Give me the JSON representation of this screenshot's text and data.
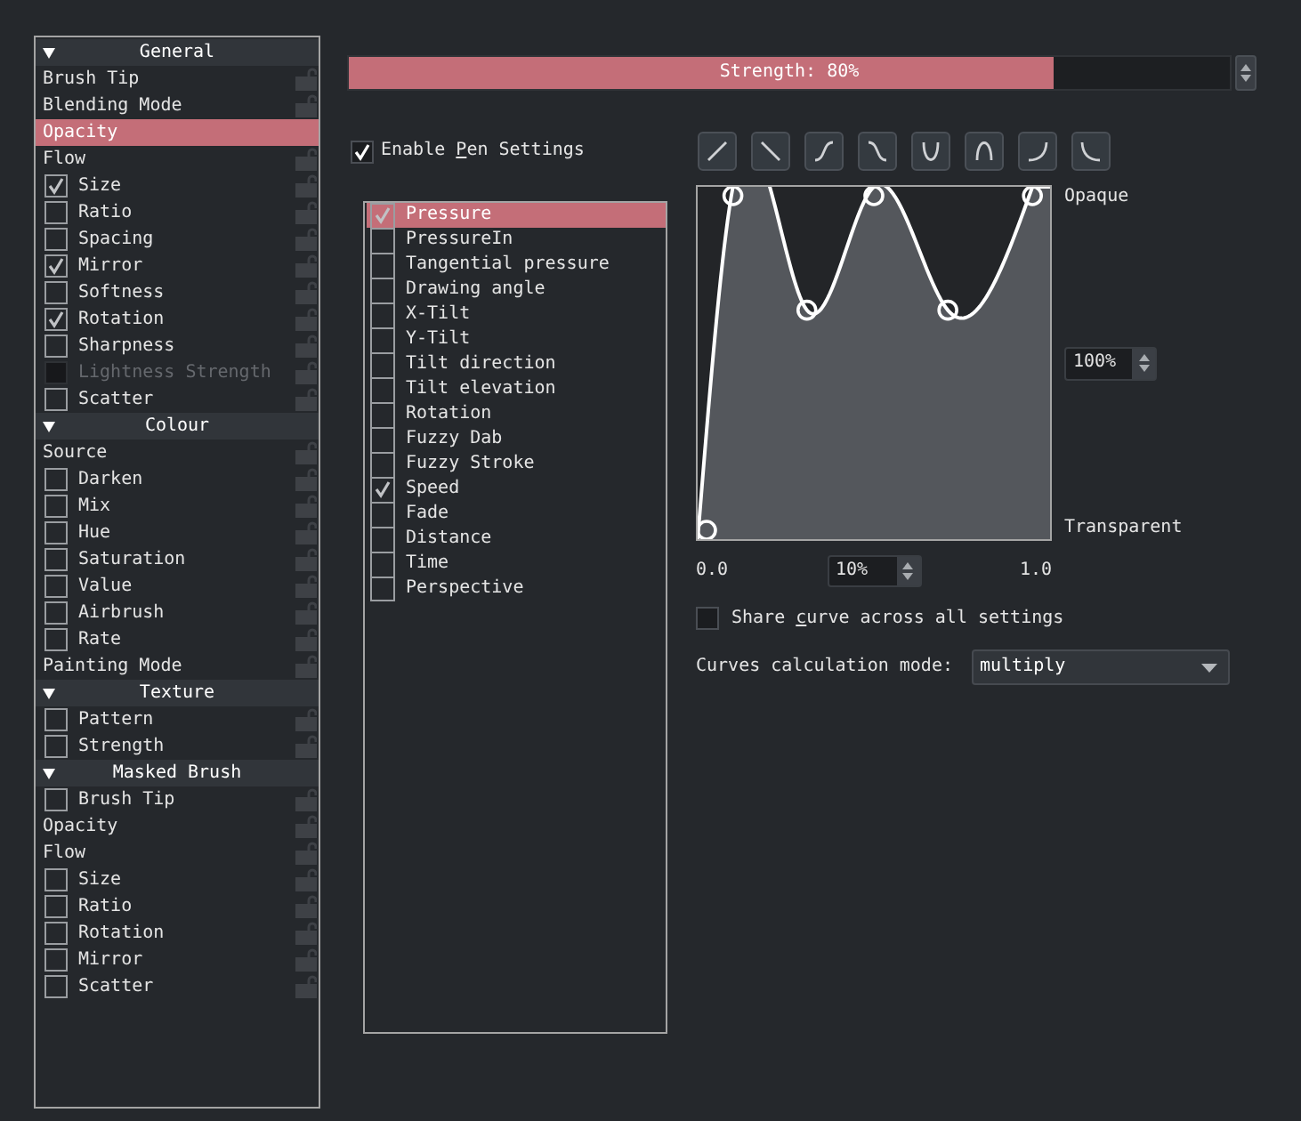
{
  "options_panel": {
    "sections": [
      {
        "title": "General",
        "expanded": true,
        "items": [
          {
            "kind": "plain",
            "label": "Brush Tip",
            "selected": false,
            "disabled": false
          },
          {
            "kind": "plain",
            "label": "Blending Mode",
            "selected": false,
            "disabled": false
          },
          {
            "kind": "plain",
            "label": "Opacity",
            "selected": true,
            "disabled": false
          },
          {
            "kind": "plain",
            "label": "Flow",
            "selected": false,
            "disabled": false
          },
          {
            "kind": "checkbox",
            "label": "Size",
            "checked": true,
            "selected": false,
            "disabled": false
          },
          {
            "kind": "checkbox",
            "label": "Ratio",
            "checked": false,
            "selected": false,
            "disabled": false
          },
          {
            "kind": "checkbox",
            "label": "Spacing",
            "checked": false,
            "selected": false,
            "disabled": false
          },
          {
            "kind": "checkbox",
            "label": "Mirror",
            "checked": true,
            "selected": false,
            "disabled": false
          },
          {
            "kind": "checkbox",
            "label": "Softness",
            "checked": false,
            "selected": false,
            "disabled": false
          },
          {
            "kind": "checkbox",
            "label": "Rotation",
            "checked": true,
            "selected": false,
            "disabled": false
          },
          {
            "kind": "checkbox",
            "label": "Sharpness",
            "checked": false,
            "selected": false,
            "disabled": false
          },
          {
            "kind": "checkbox",
            "label": "Lightness Strength",
            "checked": false,
            "selected": false,
            "disabled": true
          },
          {
            "kind": "checkbox",
            "label": "Scatter",
            "checked": false,
            "selected": false,
            "disabled": false
          }
        ]
      },
      {
        "title": "Colour",
        "expanded": true,
        "items": [
          {
            "kind": "plain",
            "label": "Source",
            "selected": false,
            "disabled": false
          },
          {
            "kind": "checkbox",
            "label": "Darken",
            "checked": false,
            "selected": false,
            "disabled": false
          },
          {
            "kind": "checkbox",
            "label": "Mix",
            "checked": false,
            "selected": false,
            "disabled": false
          },
          {
            "kind": "checkbox",
            "label": "Hue",
            "checked": false,
            "selected": false,
            "disabled": false
          },
          {
            "kind": "checkbox",
            "label": "Saturation",
            "checked": false,
            "selected": false,
            "disabled": false
          },
          {
            "kind": "checkbox",
            "label": "Value",
            "checked": false,
            "selected": false,
            "disabled": false
          },
          {
            "kind": "checkbox",
            "label": "Airbrush",
            "checked": false,
            "selected": false,
            "disabled": false
          },
          {
            "kind": "checkbox",
            "label": "Rate",
            "checked": false,
            "selected": false,
            "disabled": false
          },
          {
            "kind": "plain",
            "label": "Painting Mode",
            "selected": false,
            "disabled": false
          }
        ]
      },
      {
        "title": "Texture",
        "expanded": true,
        "items": [
          {
            "kind": "checkbox",
            "label": "Pattern",
            "checked": false,
            "selected": false,
            "disabled": false
          },
          {
            "kind": "checkbox",
            "label": "Strength",
            "checked": false,
            "selected": false,
            "disabled": false
          }
        ]
      },
      {
        "title": "Masked Brush",
        "expanded": true,
        "items": [
          {
            "kind": "checkbox",
            "label": "Brush Tip",
            "checked": false,
            "selected": false,
            "disabled": false
          },
          {
            "kind": "plain",
            "label": "Opacity",
            "selected": false,
            "disabled": false
          },
          {
            "kind": "plain",
            "label": "Flow",
            "selected": false,
            "disabled": false
          },
          {
            "kind": "checkbox",
            "label": "Size",
            "checked": false,
            "selected": false,
            "disabled": false
          },
          {
            "kind": "checkbox",
            "label": "Ratio",
            "checked": false,
            "selected": false,
            "disabled": false
          },
          {
            "kind": "checkbox",
            "label": "Rotation",
            "checked": false,
            "selected": false,
            "disabled": false
          },
          {
            "kind": "checkbox",
            "label": "Mirror",
            "checked": false,
            "selected": false,
            "disabled": false
          },
          {
            "kind": "checkbox",
            "label": "Scatter",
            "checked": false,
            "selected": false,
            "disabled": false
          }
        ]
      }
    ]
  },
  "strength_slider": {
    "label": "Strength: 80%",
    "level": 0.8
  },
  "pen_settings": {
    "label": {
      "before": "Enable ",
      "mnemonic": "P",
      "after": "en Settings"
    },
    "checked": true
  },
  "sensors": [
    {
      "label": "Pressure",
      "checked": true,
      "selected": true
    },
    {
      "label": "PressureIn",
      "checked": false,
      "selected": false
    },
    {
      "label": "Tangential pressure",
      "checked": false,
      "selected": false
    },
    {
      "label": "Drawing angle",
      "checked": false,
      "selected": false
    },
    {
      "label": "X-Tilt",
      "checked": false,
      "selected": false
    },
    {
      "label": "Y-Tilt",
      "checked": false,
      "selected": false
    },
    {
      "label": "Tilt direction",
      "checked": false,
      "selected": false
    },
    {
      "label": "Tilt elevation",
      "checked": false,
      "selected": false
    },
    {
      "label": "Rotation",
      "checked": false,
      "selected": false
    },
    {
      "label": "Fuzzy Dab",
      "checked": false,
      "selected": false
    },
    {
      "label": "Fuzzy Stroke",
      "checked": false,
      "selected": false
    },
    {
      "label": "Speed",
      "checked": true,
      "selected": false
    },
    {
      "label": "Fade",
      "checked": false,
      "selected": false
    },
    {
      "label": "Distance",
      "checked": false,
      "selected": false
    },
    {
      "label": "Time",
      "checked": false,
      "selected": false
    },
    {
      "label": "Perspective",
      "checked": false,
      "selected": false
    }
  ],
  "curve_presets": [
    {
      "kind": "linear-up"
    },
    {
      "kind": "linear-down"
    },
    {
      "kind": "s-up"
    },
    {
      "kind": "s-down"
    },
    {
      "kind": "u"
    },
    {
      "kind": "arch"
    },
    {
      "kind": "rise"
    },
    {
      "kind": "fall"
    }
  ],
  "curve_editor": {
    "top_label": "Opaque",
    "y_value": "100%",
    "bottom_label": "Transparent",
    "x_min_label": "0.0",
    "x_value": "10%",
    "x_max_label": "1.0"
  },
  "share_curve": {
    "label": {
      "before": "Share ",
      "mnemonic": "c",
      "after": "urve across all settings"
    },
    "checked": false
  },
  "calculation_mode": {
    "label": "Curves calculation mode:",
    "value": "multiply"
  }
}
